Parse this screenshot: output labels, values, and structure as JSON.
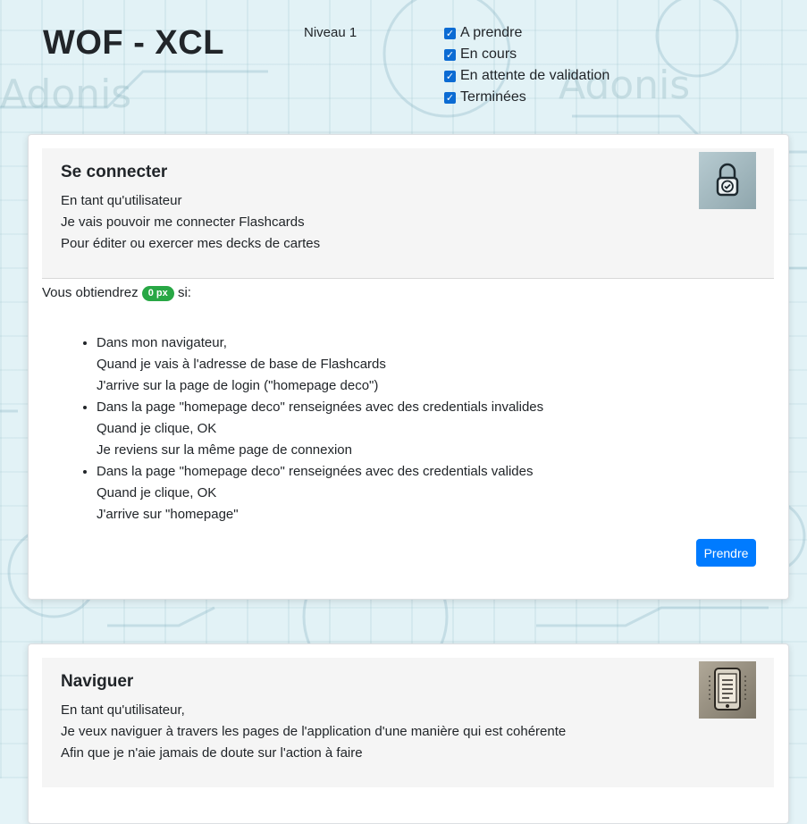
{
  "header": {
    "app_title": "WOF - XCL",
    "level": "Niveau 1",
    "filters": [
      {
        "label": "A prendre",
        "checked": true
      },
      {
        "label": "En cours",
        "checked": true
      },
      {
        "label": "En attente de validation",
        "checked": true
      },
      {
        "label": "Terminées",
        "checked": true
      }
    ]
  },
  "background": {
    "watermark": "Adonis"
  },
  "cards": [
    {
      "title": "Se connecter",
      "lines": [
        "En tant qu'utilisateur",
        "Je vais pouvoir me connecter Flashcards",
        "Pour éditer ou exercer mes decks de cartes"
      ],
      "icon": "lock-icon",
      "reward_prefix": "Vous obtiendrez",
      "reward_badge": "0 px",
      "reward_suffix": "si:",
      "criteria": [
        [
          "Dans mon navigateur,",
          "Quand je vais à l'adresse de base de Flashcards",
          "J'arrive sur la page de login (\"homepage deco\")"
        ],
        [
          "Dans la page \"homepage deco\" renseignées avec des credentials invalides",
          "Quand je clique, OK",
          "Je reviens sur la même page de connexion"
        ],
        [
          "Dans la page \"homepage deco\" renseignées avec des credentials valides",
          "Quand je clique, OK",
          "J'arrive sur \"homepage\""
        ]
      ],
      "action_label": "Prendre"
    },
    {
      "title": "Naviguer",
      "lines": [
        "En tant qu'utilisateur,",
        "Je veux naviguer à travers les pages de l'application d'une manière qui est cohérente",
        "Afin que je n'aie jamais de doute sur l'action à faire"
      ],
      "icon": "navigation-device-icon"
    }
  ],
  "colors": {
    "primary": "#007bff",
    "success": "#28a745",
    "checkbox": "#0b6bd3"
  }
}
